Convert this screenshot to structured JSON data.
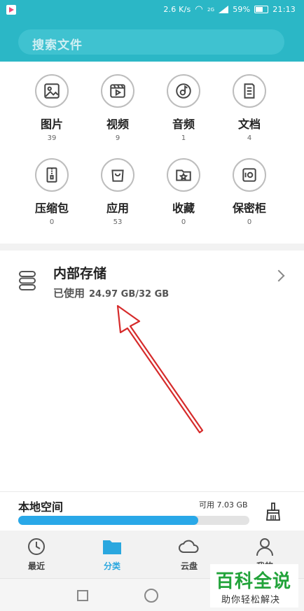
{
  "status_bar": {
    "speed": "2.6 K/s",
    "net_type": "2G",
    "battery": "59%",
    "time": "21:13"
  },
  "search": {
    "placeholder": "搜索文件"
  },
  "categories": [
    {
      "label": "图片",
      "count": "39",
      "icon": "image-icon"
    },
    {
      "label": "视频",
      "count": "9",
      "icon": "video-icon"
    },
    {
      "label": "音频",
      "count": "1",
      "icon": "music-icon"
    },
    {
      "label": "文档",
      "count": "4",
      "icon": "document-icon"
    },
    {
      "label": "压缩包",
      "count": "0",
      "icon": "zip-icon"
    },
    {
      "label": "应用",
      "count": "53",
      "icon": "app-bag-icon"
    },
    {
      "label": "收藏",
      "count": "0",
      "icon": "favorite-folder-icon"
    },
    {
      "label": "保密柜",
      "count": "0",
      "icon": "safe-icon"
    }
  ],
  "storage": {
    "title": "内部存储",
    "used_label": "已使用",
    "used_value": "24.97 GB/32 GB"
  },
  "local_space": {
    "title": "本地空间",
    "available": "可用 7.03 GB",
    "used_fraction": 0.78
  },
  "tabs": [
    {
      "label": "最近",
      "icon": "clock-icon",
      "active": false
    },
    {
      "label": "分类",
      "icon": "folder-icon",
      "active": true
    },
    {
      "label": "云盘",
      "icon": "cloud-icon",
      "active": false
    },
    {
      "label": "我的",
      "icon": "person-icon",
      "active": false
    }
  ],
  "watermark": {
    "title": "百科全说",
    "subtitle": "助你轻松解决"
  },
  "colors": {
    "header": "#2bb7c6",
    "accent": "#2aa7df",
    "progress": "#29a8e8",
    "arrow": "#d62b2b",
    "watermark": "#22a33a"
  }
}
